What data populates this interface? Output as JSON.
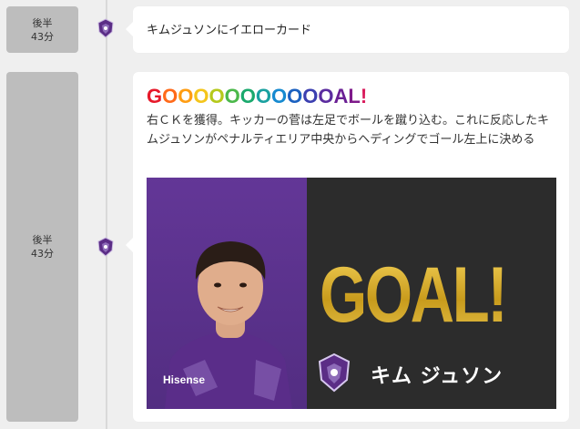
{
  "events": [
    {
      "time_line1": "後半",
      "time_line2": "43分",
      "text": "キムジュソンにイエローカード"
    },
    {
      "time_line1": "後半",
      "time_line2": "43分",
      "goal_title_letters": [
        "G",
        "O",
        "O",
        "O",
        "O",
        "O",
        "O",
        "O",
        "O",
        "O",
        "O",
        "O",
        "A",
        "L",
        "!"
      ],
      "goal_title_colors": [
        "#e6192a",
        "#ff6a1a",
        "#ff9d12",
        "#f4c51b",
        "#b5c91b",
        "#4bb84a",
        "#1aa96d",
        "#1aa1a0",
        "#168ad0",
        "#1b61c0",
        "#3b3fb0",
        "#5b2c9f",
        "#6a1f94",
        "#7e1a8a",
        "#d91a5b"
      ],
      "description": "右ＣＫを獲得。キッカーの菅は左足でボールを蹴り込む。これに反応したキムジュソンがペナルティエリア中央からヘディングでゴール左上に決める",
      "image_goal_text": "GOAL!",
      "image_player_name": "キム ジュソン",
      "image_sponsor_text": "Hisense"
    }
  ],
  "colors": {
    "team_purple": "#5b2d86",
    "gold": "#c9a227",
    "card_bg": "#ffffff",
    "page_bg": "#efefef",
    "time_chip_bg": "#bdbdbd"
  }
}
